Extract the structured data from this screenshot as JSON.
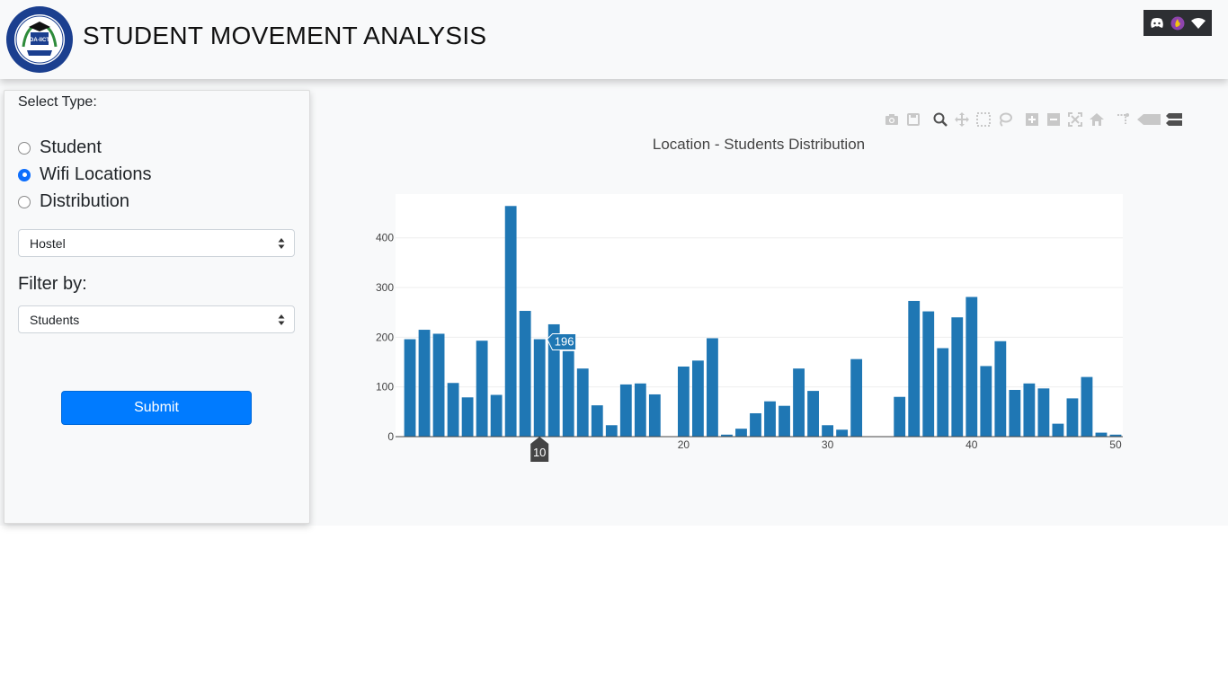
{
  "header": {
    "title": "STUDENT MOVEMENT ANALYSIS",
    "logo_text": "DA-IICT",
    "tray_icons": [
      "discord-icon",
      "app-icon",
      "wifi-icon"
    ]
  },
  "sidebar": {
    "select_type_label": "Select Type:",
    "radio_options": [
      {
        "label": "Student",
        "checked": false
      },
      {
        "label": "Wifi Locations",
        "checked": true
      },
      {
        "label": "Distribution",
        "checked": false
      }
    ],
    "location_select": {
      "value": "Hostel"
    },
    "filter_label": "Filter by:",
    "filter_select": {
      "value": "Students"
    },
    "submit_label": "Submit"
  },
  "modebar": {
    "icons": [
      "camera-icon",
      "save-icon",
      "zoom-icon",
      "pan-icon",
      "box-select-icon",
      "lasso-icon",
      "zoom-in-icon",
      "zoom-out-icon",
      "autoscale-icon",
      "reset-axes-icon",
      "spike-lines-icon",
      "hover-closest-icon",
      "hover-compare-icon"
    ]
  },
  "colors": {
    "accent": "#007bff",
    "bar": "#1f77b4",
    "radio_checked": "#0d6efd"
  },
  "chart_data": {
    "type": "bar",
    "title": "Location - Students Distribution",
    "xlabel": "",
    "ylabel": "",
    "x": [
      1,
      2,
      3,
      4,
      5,
      6,
      7,
      8,
      9,
      10,
      11,
      12,
      13,
      14,
      15,
      16,
      17,
      18,
      19,
      20,
      21,
      22,
      23,
      24,
      25,
      26,
      27,
      28,
      29,
      30,
      31,
      32,
      33,
      34,
      35,
      36,
      37,
      38,
      39,
      40,
      41,
      42,
      43,
      44,
      45,
      46,
      47,
      48,
      49,
      50
    ],
    "values": [
      196,
      215,
      207,
      108,
      79,
      193,
      84,
      464,
      253,
      196,
      226,
      172,
      137,
      63,
      23,
      105,
      107,
      85,
      0,
      141,
      153,
      198,
      4,
      16,
      47,
      71,
      62,
      137,
      92,
      23,
      14,
      156,
      0,
      0,
      80,
      273,
      252,
      178,
      240,
      281,
      142,
      192,
      94,
      107,
      97,
      26,
      77,
      120,
      8,
      4
    ],
    "xlim": [
      0,
      50.5
    ],
    "ylim": [
      0,
      488
    ],
    "xticks": [
      20,
      30,
      40,
      50
    ],
    "yticks": [
      0,
      100,
      200,
      300,
      400
    ],
    "grid": true,
    "hover": {
      "x": 10,
      "y": 196,
      "x_label": "10",
      "y_label": "196"
    }
  }
}
